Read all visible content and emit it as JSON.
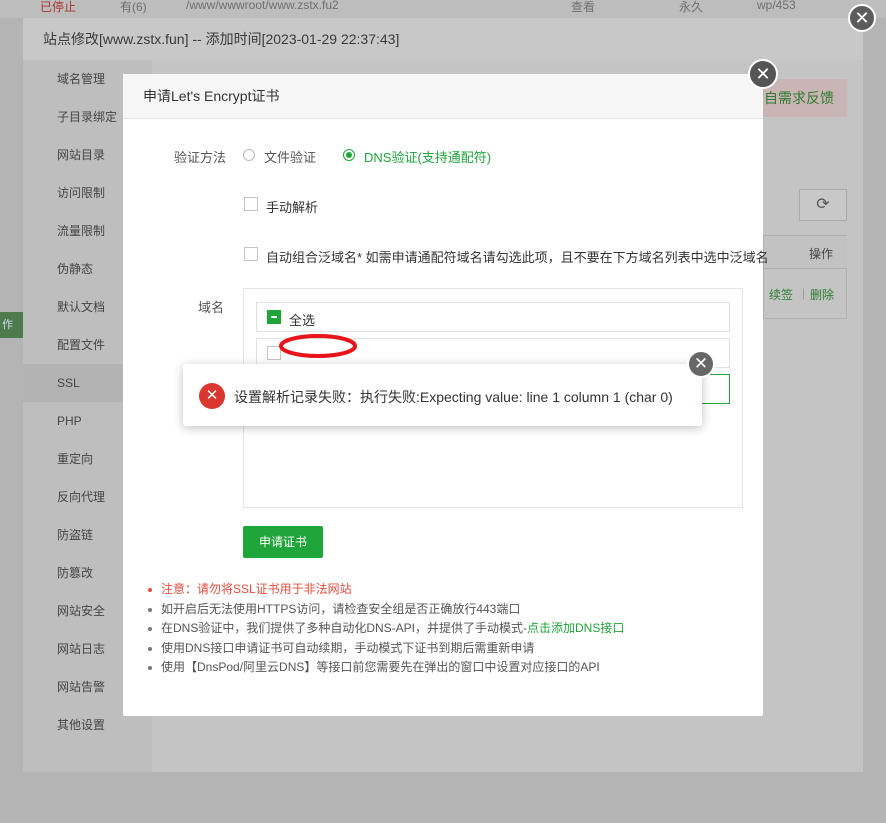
{
  "background": {
    "row": {
      "status": "已停止",
      "backups": "有(6)",
      "path": "/www/wwwroot/www.zstx.fu2",
      "view": "查看",
      "expiry": "永久",
      "remark": "wp/453"
    },
    "left_badge": "作",
    "feedback_label": "自需求反馈",
    "table_header_action": "操作",
    "renew_label": "续签",
    "delete_label": "删除"
  },
  "outer_modal": {
    "title": "站点修改[www.zstx.fun] -- 添加时间[2023-01-29 22:37:43]",
    "menu": [
      {
        "label": "域名管理"
      },
      {
        "label": "子目录绑定"
      },
      {
        "label": "网站目录"
      },
      {
        "label": "访问限制"
      },
      {
        "label": "流量限制"
      },
      {
        "label": "伪静态"
      },
      {
        "label": "默认文档"
      },
      {
        "label": "配置文件"
      },
      {
        "label": "SSL"
      },
      {
        "label": "PHP"
      },
      {
        "label": "重定向"
      },
      {
        "label": "反向代理"
      },
      {
        "label": "防盗链"
      },
      {
        "label": "防篡改"
      },
      {
        "label": "网站安全"
      },
      {
        "label": "网站日志"
      },
      {
        "label": "网站告警"
      },
      {
        "label": "其他设置"
      }
    ],
    "active_menu": "SSL"
  },
  "dialog": {
    "title": "申请Let's Encrypt证书",
    "verify_label": "验证方法",
    "option_file": "文件验证",
    "option_dns": "DNS验证(支持通配符)",
    "selected_option": "DNS验证(支持通配符)",
    "manual_resolve": "手动解析",
    "auto_wildcard": "自动组合泛域名* 如需申请通配符域名请勾选此项，且不要在下方域名列表中选中泛域名",
    "domain_label": "域名",
    "select_all": "全选",
    "apply_button": "申请证书",
    "tips": [
      {
        "text": "注意：请勿将SSL证书用于非法网站",
        "type": "warn"
      },
      {
        "text": "如开启后无法使用HTTPS访问，请检查安全组是否正确放行443端口",
        "type": "normal"
      },
      {
        "text": "在DNS验证中，我们提供了多种自动化DNS-API，并提供了手动模式-",
        "link": "点击添加DNS接口",
        "type": "normal"
      },
      {
        "text": "使用DNS接口申请证书可自动续期，手动模式下证书到期后需重新申请",
        "type": "normal"
      },
      {
        "text": "使用【DnsPod/阿里云DNS】等接口前您需要先在弹出的窗口中设置对应接口的API",
        "type": "normal"
      }
    ]
  },
  "toast": {
    "message": "设置解析记录失败：执行失败:Expecting value: line 1 column 1 (char 0)"
  },
  "colors": {
    "primary_green": "#20a53a",
    "error_red": "#d9372f",
    "warn_text": "#e24e3f"
  }
}
